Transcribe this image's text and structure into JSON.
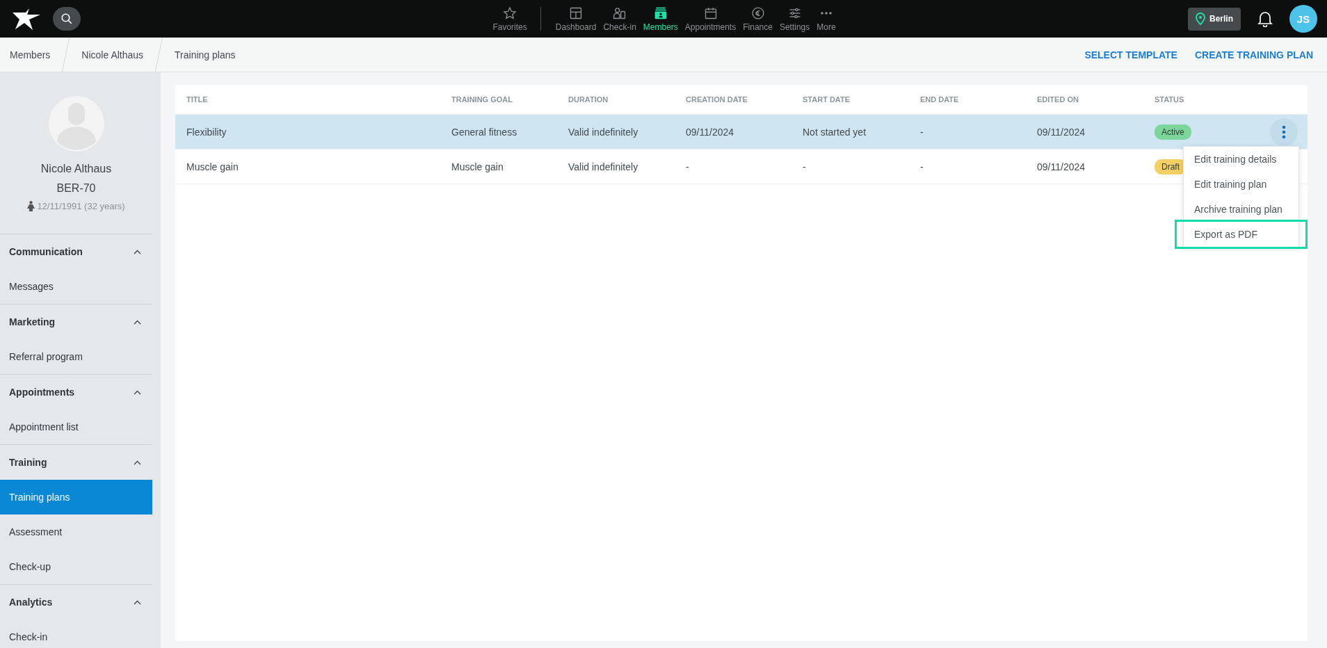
{
  "topbar": {
    "favorites": {
      "label": "Favorites"
    },
    "nav": [
      {
        "label": "Dashboard",
        "kind": "dashboard",
        "selected": false
      },
      {
        "label": "Check-in",
        "kind": "checkin",
        "selected": false
      },
      {
        "label": "Members",
        "kind": "members",
        "selected": true
      },
      {
        "label": "Appointments",
        "kind": "calendar",
        "selected": false
      },
      {
        "label": "Finance",
        "kind": "euro",
        "selected": false
      },
      {
        "label": "Settings",
        "kind": "sliders",
        "selected": false
      },
      {
        "label": "More",
        "kind": "more",
        "selected": false
      }
    ],
    "location": "Berlin",
    "user_initials": "JS"
  },
  "breadcrumbs": [
    "Members",
    "Nicole Althaus",
    "Training plans"
  ],
  "actions": [
    "SELECT TEMPLATE",
    "CREATE TRAINING PLAN"
  ],
  "profile": {
    "name": "Nicole Althaus",
    "member_id": "BER-70",
    "birth": "12/11/1991 (32 years)"
  },
  "sidebar": [
    {
      "label": "Communication",
      "expanded": true,
      "items": [
        {
          "label": "Messages",
          "selected": false
        }
      ]
    },
    {
      "label": "Marketing",
      "expanded": true,
      "items": [
        {
          "label": "Referral program",
          "selected": false
        }
      ]
    },
    {
      "label": "Appointments",
      "expanded": true,
      "items": [
        {
          "label": "Appointment list",
          "selected": false
        }
      ]
    },
    {
      "label": "Training",
      "expanded": true,
      "items": [
        {
          "label": "Training plans",
          "selected": true
        },
        {
          "label": "Assessment",
          "selected": false
        },
        {
          "label": "Check-up",
          "selected": false
        }
      ]
    },
    {
      "label": "Analytics",
      "expanded": true,
      "items": [
        {
          "label": "Check-in",
          "selected": false
        }
      ]
    }
  ],
  "table": {
    "columns": [
      "TITLE",
      "TRAINING GOAL",
      "DURATION",
      "CREATION DATE",
      "START DATE",
      "END DATE",
      "EDITED ON",
      "STATUS"
    ],
    "rows": [
      {
        "cells": [
          "Flexibility",
          "General fitness",
          "Valid indefinitely",
          "09/11/2024",
          "Not started yet",
          "-",
          "09/11/2024"
        ],
        "status": {
          "label": "Active",
          "color": "#7cd69b"
        },
        "selected": true,
        "menu_open": true
      },
      {
        "cells": [
          "Muscle gain",
          "Muscle gain",
          "Valid indefinitely",
          "-",
          "-",
          "-",
          "09/11/2024"
        ],
        "status": {
          "label": "Draft",
          "color": "#f4cf66"
        },
        "selected": false,
        "menu_open": false
      }
    ],
    "row_menu": [
      {
        "label": "Edit training details",
        "outlined": false
      },
      {
        "label": "Edit training plan",
        "outlined": false
      },
      {
        "label": "Archive training plan",
        "outlined": false
      },
      {
        "label": "Export as PDF",
        "outlined": true
      }
    ]
  }
}
